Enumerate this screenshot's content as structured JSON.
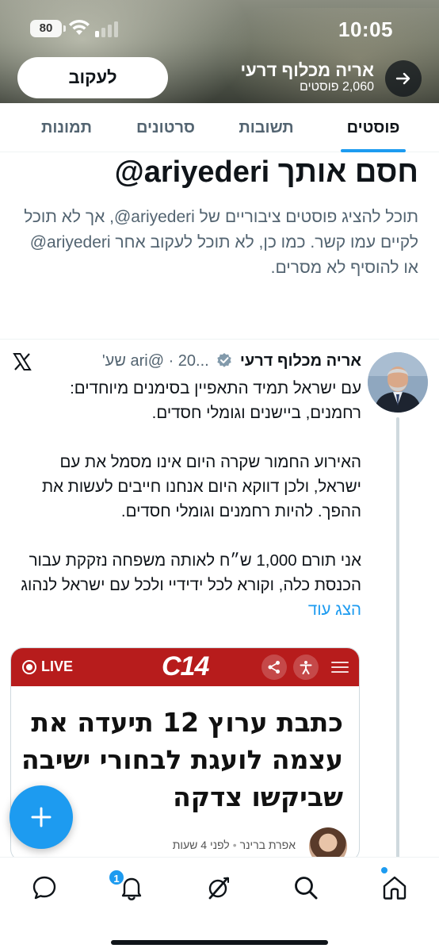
{
  "status_bar": {
    "time": "10:05",
    "battery": "80"
  },
  "header": {
    "profile_name": "אריה מכלוף דרעי",
    "posts_count": "2,060 פוסטים",
    "follow_label": "לעקוב"
  },
  "tabs": [
    {
      "label": "פוסטים",
      "active": true
    },
    {
      "label": "תשובות",
      "active": false
    },
    {
      "label": "סרטונים",
      "active": false
    },
    {
      "label": "תמונות",
      "active": false
    }
  ],
  "blocked": {
    "title": "חסם אותך ariyederi@",
    "body": "תוכל להציג פוסטים ציבוריים של ariyederi@, אך לא תוכל לקיים עמו קשר. כמו כן, לא תוכל לעקוב אחר ariyederi@ או להוסיף לא מסרים."
  },
  "tweet": {
    "author_name": "אריה מכלוף דרעי",
    "handle_time": "...ari@ · 20 שע'",
    "paragraphs": [
      "עם ישראל תמיד התאפיין בסימנים מיוחדים: רחמנים, ביישנים וגומלי חסדים.",
      "האירוע החמור שקרה היום אינו מסמל את עם ישראל, ולכן דווקא היום אנחנו חייבים לעשות את ההפך. להיות רחמנים וגומלי חסדים."
    ],
    "last_paragraph": "אני תורם 1,000 ש״ח לאותה משפחה נזקקת עבור הכנסת כלה, וקורא לכל ידידיי ולכל עם ישראל לנהוג",
    "show_more": "הצג עוד"
  },
  "card": {
    "live_label": "LIVE",
    "logo_text": "C14",
    "headline": "כתבת ערוץ 12 תיעדה את עצמה לועגת לבחורי ישיבה שביקשו צדקה",
    "author": "אפרת ברינר",
    "time_ago": "לפני 4 שעות"
  },
  "bottom_nav": {
    "notification_badge": "1"
  },
  "colors": {
    "accent": "#1d9bf0",
    "card_bar": "#b71c1c"
  }
}
